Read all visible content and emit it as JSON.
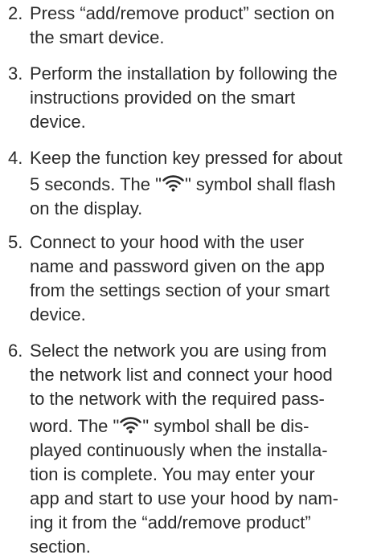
{
  "steps": [
    {
      "number": "2.",
      "lines": [
        "Press “add/remove product” section on",
        "the smart device."
      ]
    },
    {
      "number": "3.",
      "lines": [
        "Perform the installation by following the",
        "instructions provided on the smart",
        "device."
      ]
    },
    {
      "number": "4.",
      "lines": [
        "Keep the function key pressed for about",
        "5 seconds. The \"",
        "\" symbol shall flash",
        "on the display."
      ]
    },
    {
      "number": "5.",
      "lines": [
        "Connect to your hood with the user",
        "name and password given on the app",
        "from the settings section of your smart",
        "device."
      ]
    },
    {
      "number": "6.",
      "lines": [
        "Select the network you are using from",
        "the network list and connect your hood",
        "to the network with the required pass-",
        "word. The \"",
        "\" symbol shall be dis-",
        "played continuously when the installa-",
        "tion is complete. You may enter your",
        "app and start to use your hood by nam-",
        "ing it from the “add/remove product”",
        "section."
      ]
    }
  ],
  "icons": {
    "wifi": "wifi-icon"
  },
  "colors": {
    "text": "#2b2b2b",
    "background": "#ffffff"
  }
}
